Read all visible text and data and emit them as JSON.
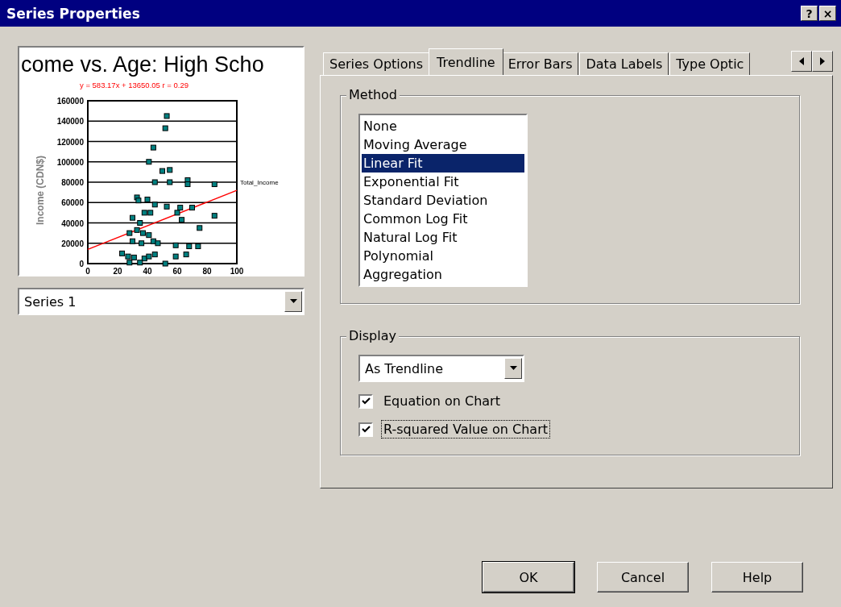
{
  "window": {
    "title": "Series Properties",
    "buttons": [
      "?",
      "×"
    ]
  },
  "preview": {
    "title": "come vs. Age: High Scho",
    "chart_data": {
      "type": "scatter",
      "grid": true,
      "ylabel": "Income (CDN$)",
      "xlim": [
        0,
        100
      ],
      "ylim": [
        0,
        160000
      ],
      "xticks": [
        0,
        20,
        40,
        60,
        80,
        100
      ],
      "yticks": [
        0,
        20000,
        40000,
        60000,
        80000,
        100000,
        120000,
        140000,
        160000
      ],
      "series": [
        {
          "name": "Total_Income",
          "type": "scatter",
          "color": "#008080",
          "x": [
            53,
            52,
            44,
            41,
            50,
            55,
            45,
            55,
            67,
            67,
            85,
            33,
            34,
            40,
            45,
            53,
            62,
            70,
            85,
            60,
            63,
            75,
            30,
            35,
            38,
            42,
            28,
            33,
            37,
            41,
            44,
            47,
            30,
            36,
            59,
            68,
            74,
            23,
            27,
            31,
            38,
            41,
            45,
            59,
            66,
            28,
            35,
            52
          ],
          "values": [
            145000,
            133000,
            114000,
            100000,
            91000,
            92000,
            80000,
            80000,
            82000,
            78000,
            78000,
            65000,
            62000,
            63000,
            58000,
            56000,
            55000,
            55000,
            47000,
            50000,
            43000,
            35000,
            45000,
            40000,
            50000,
            50000,
            30000,
            33000,
            30000,
            28000,
            22000,
            20000,
            22000,
            20000,
            18000,
            17000,
            17000,
            10000,
            7000,
            6000,
            5000,
            7000,
            9000,
            7000,
            9000,
            1000,
            1000,
            0
          ]
        },
        {
          "type": "line",
          "color": "#ff0000",
          "x": [
            0,
            100
          ],
          "values": [
            14000,
            72000
          ]
        }
      ],
      "annotations": [
        "y = 583.17x + 13650.05 r = 0.29"
      ]
    }
  },
  "series_select": {
    "value": "Series 1"
  },
  "tabs": [
    {
      "label": "Series Options",
      "selected": false
    },
    {
      "label": "Trendline",
      "selected": true
    },
    {
      "label": "Error Bars",
      "selected": false
    },
    {
      "label": "Data Labels",
      "selected": false
    },
    {
      "label": "Type Optic",
      "selected": false
    }
  ],
  "method": {
    "label": "Method",
    "items": [
      {
        "label": "None",
        "selected": false
      },
      {
        "label": "Moving Average",
        "selected": false
      },
      {
        "label": "Linear Fit",
        "selected": true
      },
      {
        "label": "Exponential Fit",
        "selected": false
      },
      {
        "label": "Standard Deviation",
        "selected": false
      },
      {
        "label": "Common Log Fit",
        "selected": false
      },
      {
        "label": "Natural Log Fit",
        "selected": false
      },
      {
        "label": "Polynomial",
        "selected": false
      },
      {
        "label": "Aggregation",
        "selected": false
      }
    ]
  },
  "display": {
    "label": "Display",
    "select": {
      "value": "As Trendline"
    },
    "checkboxes": [
      {
        "label": "Equation on Chart",
        "checked": true,
        "focused": false
      },
      {
        "label": "R-squared Value on Chart",
        "checked": true,
        "focused": true
      }
    ]
  },
  "buttons": [
    "OK",
    "Cancel",
    "Help"
  ]
}
